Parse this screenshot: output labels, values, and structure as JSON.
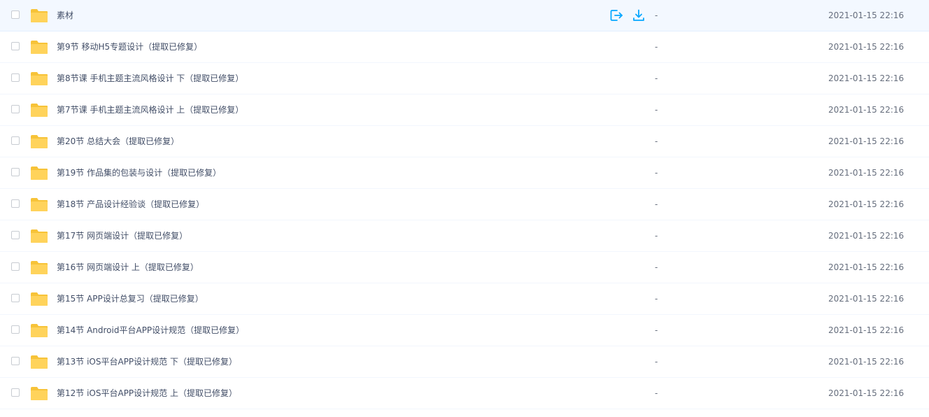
{
  "files": [
    {
      "name": "素材",
      "size": "-",
      "time": "2021-01-15 22:16"
    },
    {
      "name": "第9节 移动H5专题设计（提取已修复）",
      "size": "-",
      "time": "2021-01-15 22:16"
    },
    {
      "name": "第8节课 手机主题主流风格设计 下（提取已修复）",
      "size": "-",
      "time": "2021-01-15 22:16"
    },
    {
      "name": "第7节课 手机主题主流风格设计 上（提取已修复）",
      "size": "-",
      "time": "2021-01-15 22:16"
    },
    {
      "name": "第20节 总结大会（提取已修复）",
      "size": "-",
      "time": "2021-01-15 22:16"
    },
    {
      "name": "第19节 作品集的包装与设计（提取已修复）",
      "size": "-",
      "time": "2021-01-15 22:16"
    },
    {
      "name": "第18节 产品设计经验谈（提取已修复）",
      "size": "-",
      "time": "2021-01-15 22:16"
    },
    {
      "name": "第17节 网页端设计（提取已修复）",
      "size": "-",
      "time": "2021-01-15 22:16"
    },
    {
      "name": "第16节 网页端设计 上（提取已修复）",
      "size": "-",
      "time": "2021-01-15 22:16"
    },
    {
      "name": "第15节 APP设计总复习（提取已修复）",
      "size": "-",
      "time": "2021-01-15 22:16"
    },
    {
      "name": "第14节 Android平台APP设计规范（提取已修复）",
      "size": "-",
      "time": "2021-01-15 22:16"
    },
    {
      "name": "第13节 iOS平台APP设计规范 下（提取已修复）",
      "size": "-",
      "time": "2021-01-15 22:16"
    },
    {
      "name": "第12节 iOS平台APP设计规范 上（提取已修复）",
      "size": "-",
      "time": "2021-01-15 22:16"
    }
  ],
  "icons": {
    "folder": "folder-icon",
    "share": "share-icon",
    "download": "download-icon",
    "checkbox": "checkbox"
  },
  "colors": {
    "folder": "#ffd35b",
    "folder_tab": "#f7c338",
    "accent": "#06a7ff",
    "hover_row": "#f3f8ff"
  }
}
